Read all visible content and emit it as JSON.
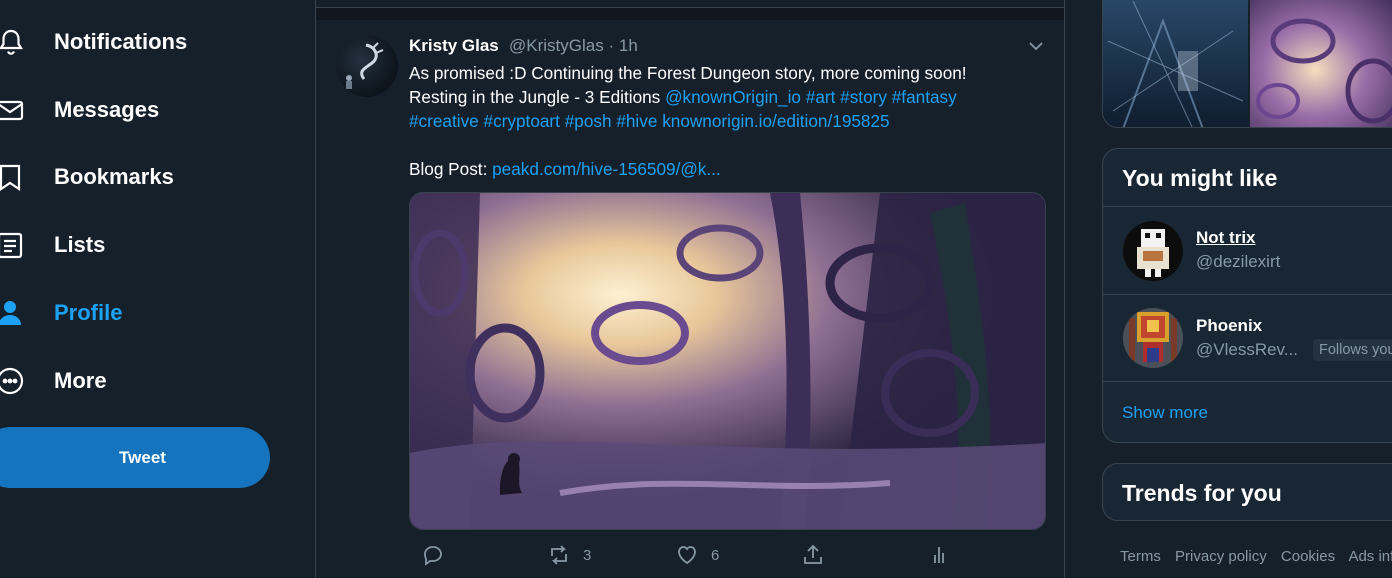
{
  "nav": {
    "items": [
      {
        "label": "Notifications",
        "icon": "bell-icon"
      },
      {
        "label": "Messages",
        "icon": "envelope-icon"
      },
      {
        "label": "Bookmarks",
        "icon": "bookmark-icon"
      },
      {
        "label": "Lists",
        "icon": "list-icon"
      },
      {
        "label": "Profile",
        "icon": "person-icon",
        "active": true
      },
      {
        "label": "More",
        "icon": "more-icon"
      }
    ],
    "tweet_button": "Tweet"
  },
  "tweet": {
    "author_name": "Kristy Glas",
    "author_handle": "@KristyGlas",
    "separator": "·",
    "time": "1h",
    "text_line1": "As promised :D Continuing the Forest Dungeon story, more coming soon!",
    "text_line2": "Resting in the Jungle - 3 Editions ",
    "mention": "@knownOrigin_io",
    "tags_line2": "#art #story #fantasy",
    "tags_line3": "#creative #cryptoart #posh #hive",
    "link1": "knownorigin.io/edition/195825",
    "blog_label": "Blog Post: ",
    "blog_link": "peakd.com/hive-156509/@k...",
    "image_alt": "Painting of a dark purple forest with glowing light and a small figure sitting",
    "actions": {
      "reply_count": "",
      "retweet_count": "3",
      "like_count": "6"
    }
  },
  "sidebar": {
    "who_to_follow": {
      "title": "You might like",
      "users": [
        {
          "name": "Not trix",
          "handle": "@dezilexirt"
        },
        {
          "name": "Phoenix",
          "handle": "@VlessRev...",
          "badge": "Follows you"
        }
      ],
      "show_more": "Show more"
    },
    "trends": {
      "title": "Trends for you"
    },
    "footer": [
      "Terms",
      "Privacy policy",
      "Cookies",
      "Ads info"
    ]
  },
  "colors": {
    "background": "#15202b",
    "card": "#192734",
    "border": "#38444d",
    "accent": "#1da1f2",
    "tweet_button": "#1574bd",
    "muted": "#8899a6"
  }
}
